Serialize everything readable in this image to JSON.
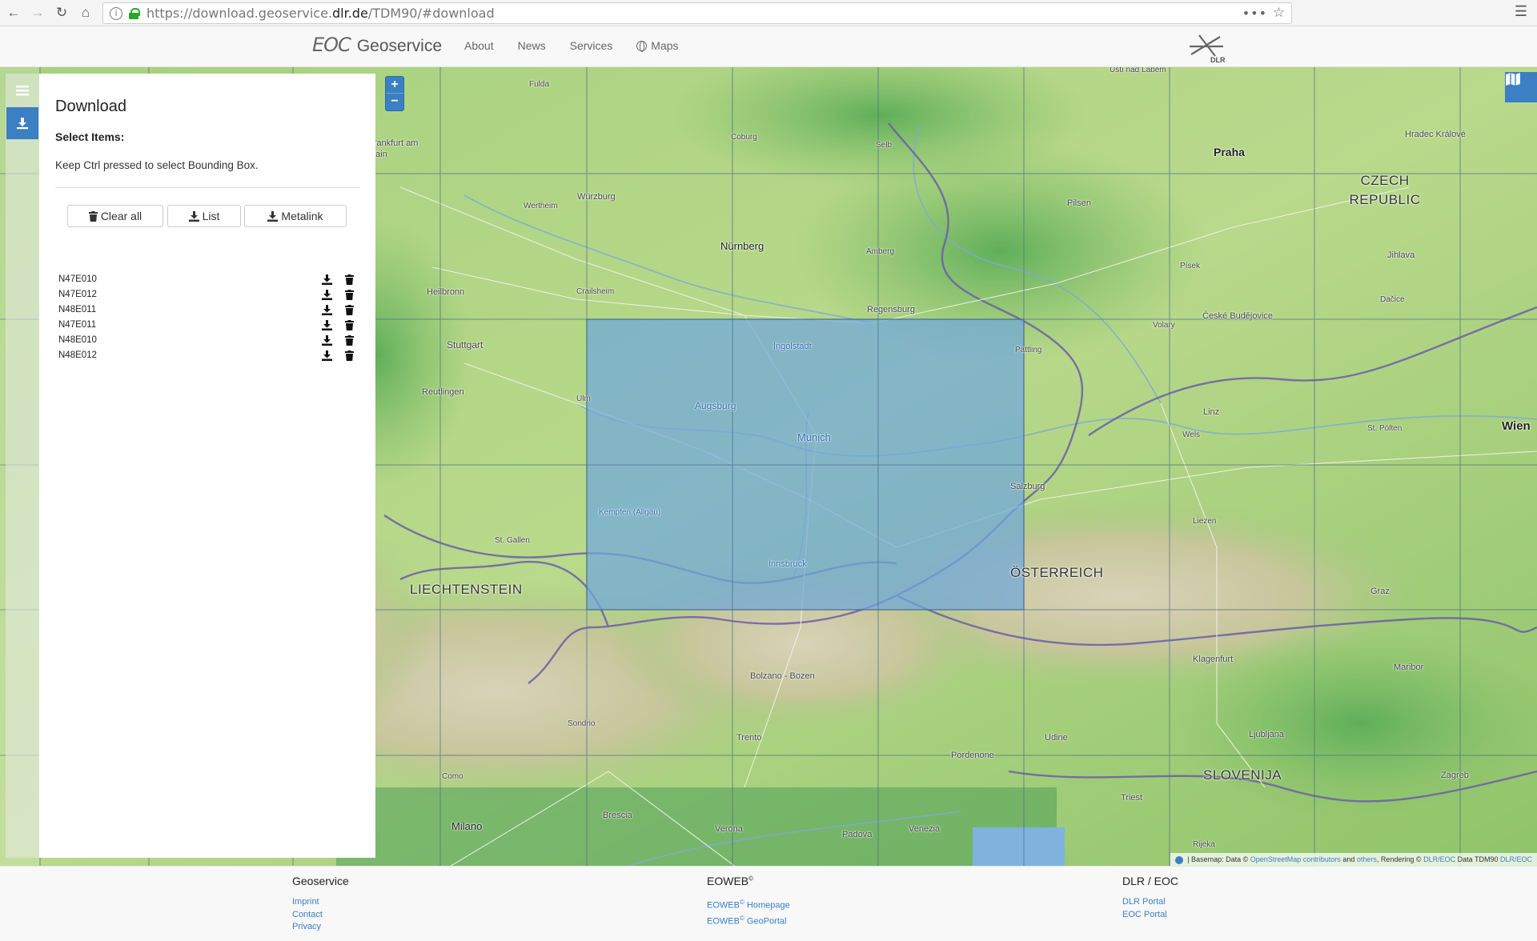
{
  "browser": {
    "url_prefix": "https://download.geoservice.",
    "url_domain": "dlr.de",
    "url_suffix": "/TDM90/#download",
    "info_icon": "info-icon",
    "lock_icon": "lock-icon"
  },
  "header": {
    "brand_eoc": "EOC",
    "brand_name": "Geoservice",
    "nav": [
      "About",
      "News",
      "Services",
      "Maps"
    ],
    "partner_logo_text": "DLR"
  },
  "panel": {
    "title": "Download",
    "subtitle": "Select Items:",
    "hint": "Keep Ctrl pressed to select Bounding Box.",
    "buttons": {
      "clear_all": "Clear all",
      "list": "List",
      "metalink": "Metalink"
    },
    "tiles": [
      "N47E010",
      "N47E012",
      "N48E011",
      "N47E011",
      "N48E010",
      "N48E012"
    ]
  },
  "map": {
    "zoom_in": "+",
    "zoom_out": "−",
    "attribution": {
      "prefix": "| Basemap: Data ©",
      "osm": "OpenStreetMap contributors",
      "and": "and",
      "others": "others",
      "rendering": ", Rendering ©",
      "dlr_eoc": "DLR/EOC",
      "data": "Data TDM90",
      "dlr_eoc2": "DLR/EOC"
    },
    "labels": {
      "cities": [
        "Praha",
        "Wien",
        "Nürnberg",
        "Regensburg",
        "Stuttgart",
        "Ingolstadt",
        "Augsburg",
        "Munich",
        "Salzburg",
        "Innsbruck",
        "Linz",
        "Graz",
        "Ljubljana",
        "Zagreb",
        "Udine",
        "Trento",
        "Milano",
        "Verona",
        "Venezia",
        "Padova",
        "Brescia",
        "Bolzano - Bozen",
        "Klagenfurt",
        "Maribor",
        "Pilsen",
        "Jihlava",
        "Hradec Králové",
        "České Budějovice",
        "Würzburg",
        "Heilbronn",
        "Wertheim",
        "Coburg",
        "Selb",
        "Amberg",
        "Písek",
        "Dačice",
        "Volary",
        "Pattling",
        "Ulm",
        "Reutlingen",
        "Crailsheim",
        "Fulda",
        "Ústí nad Labem",
        "Kempten (Allgäu)",
        "St. Gallen",
        "Como",
        "Sondrio",
        "Pordenone",
        "Triest",
        "Rijeka",
        "St. Pölten",
        "Wels",
        "Liezen",
        "Frankfurt am Main"
      ],
      "countries": [
        "CZECH REPUBLIC",
        "ÖSTERREICH",
        "LIECHTENSTEIN",
        "SLOVENIJA"
      ]
    }
  },
  "footer": {
    "col1": {
      "title": "Geoservice",
      "links": [
        "Imprint",
        "Contact",
        "Privacy"
      ]
    },
    "col2": {
      "title": "EOWEB",
      "links": [
        "EOWEB Homepage",
        "EOWEB GeoPortal"
      ]
    },
    "col3": {
      "title": "DLR / EOC",
      "links": [
        "DLR Portal",
        "EOC Portal"
      ]
    }
  },
  "colors": {
    "accent": "#3b7fc4",
    "selection_fill": "#6fa8dc",
    "grid_line": "#4a6a8a"
  }
}
